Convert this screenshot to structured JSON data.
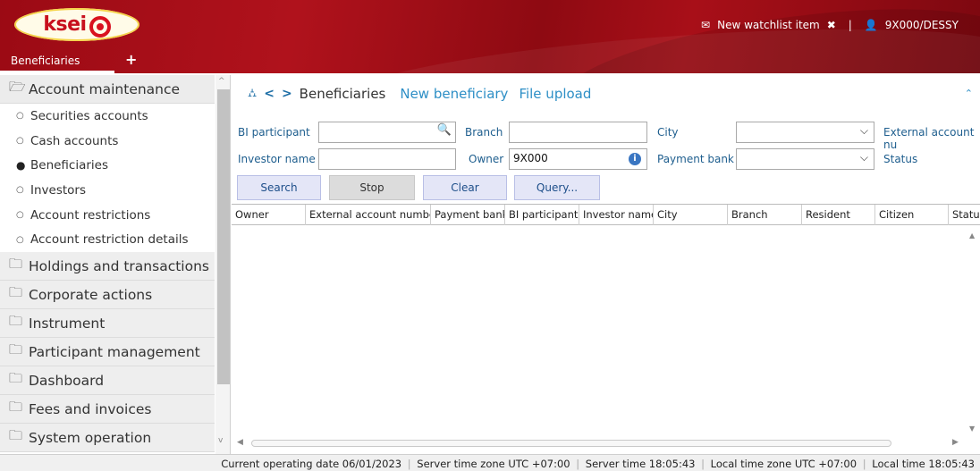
{
  "header": {
    "logo_text": "ksei",
    "watchlist_label": "New watchlist item",
    "user_label": "9X000/DESSY",
    "tab_label": "Beneficiaries",
    "add_tab_symbol": "+"
  },
  "sidebar": {
    "sections": [
      {
        "label": "Account maintenance",
        "open": true
      },
      {
        "label": "Holdings and transactions"
      },
      {
        "label": "Corporate actions"
      },
      {
        "label": "Instrument"
      },
      {
        "label": "Participant management"
      },
      {
        "label": "Dashboard"
      },
      {
        "label": "Fees and invoices"
      },
      {
        "label": "System operation"
      }
    ],
    "sub_items": [
      {
        "label": "Securities accounts"
      },
      {
        "label": "Cash accounts"
      },
      {
        "label": "Beneficiaries",
        "active": true
      },
      {
        "label": "Investors"
      },
      {
        "label": "Account restrictions"
      },
      {
        "label": "Account restriction details"
      }
    ]
  },
  "main": {
    "title": "Beneficiaries",
    "links": {
      "new_beneficiary": "New beneficiary",
      "file_upload": "File upload"
    },
    "form": {
      "bi_participant": {
        "label": "BI participant",
        "value": ""
      },
      "branch": {
        "label": "Branch",
        "value": ""
      },
      "city": {
        "label": "City",
        "value": ""
      },
      "external_account": {
        "label": "External account nu"
      },
      "investor_name": {
        "label": "Investor name",
        "value": ""
      },
      "owner": {
        "label": "Owner",
        "value": "9X000"
      },
      "payment_bank": {
        "label": "Payment bank",
        "value": ""
      },
      "status": {
        "label": "Status"
      }
    },
    "buttons": {
      "search": "Search",
      "stop": "Stop",
      "clear": "Clear",
      "query": "Query..."
    },
    "columns": [
      "Owner",
      "External account number",
      "Payment bank",
      "BI participant",
      "Investor name",
      "City",
      "Branch",
      "Resident",
      "Citizen",
      "Status"
    ]
  },
  "statusbar": {
    "operating_date": "Current operating date  06/01/2023",
    "server_tz": "Server time zone  UTC +07:00",
    "server_time": "Server time  18:05:43",
    "local_tz": "Local time zone  UTC +07:00",
    "local_time": "Local time  18:05:43"
  },
  "colors": {
    "header_red": "#a80f18",
    "link_blue": "#2e8fc6",
    "label_blue": "#1e5e8e",
    "button_bg": "#e4e6f7"
  }
}
